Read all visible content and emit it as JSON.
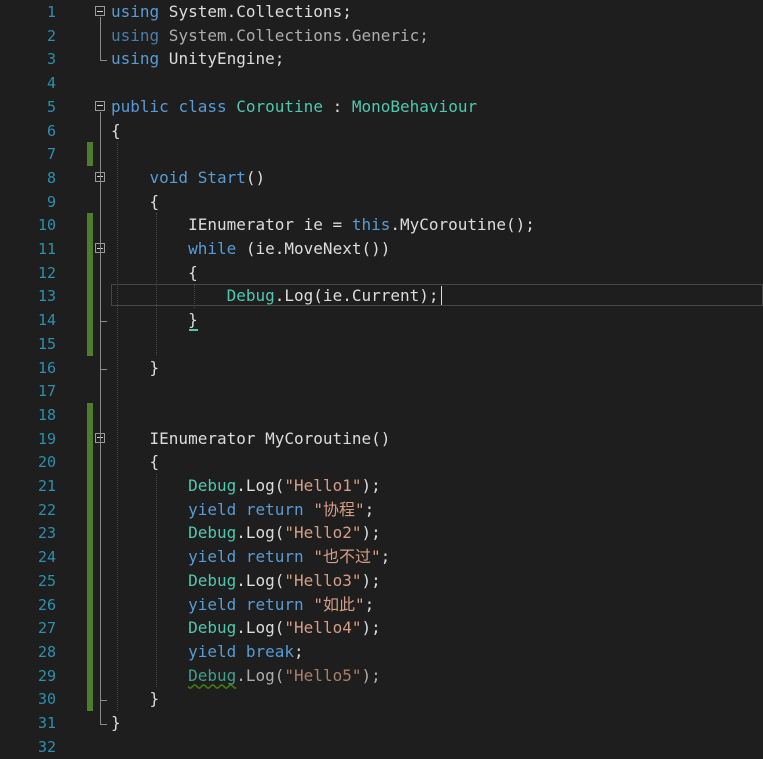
{
  "editor": {
    "lines": [
      {
        "n": "1",
        "tokens": [
          {
            "t": "using",
            "c": "kw"
          },
          {
            "t": " System.Collections;",
            "c": "id"
          }
        ]
      },
      {
        "n": "2",
        "tokens": [
          {
            "t": "using",
            "c": "kw"
          },
          {
            "t": " System.Collections.Generic;",
            "c": "id"
          }
        ],
        "dim": true
      },
      {
        "n": "3",
        "tokens": [
          {
            "t": "using",
            "c": "kw"
          },
          {
            "t": " UnityEngine;",
            "c": "id"
          }
        ]
      },
      {
        "n": "4",
        "tokens": []
      },
      {
        "n": "5",
        "tokens": [
          {
            "t": "public",
            "c": "kw"
          },
          {
            "t": " ",
            "c": "id"
          },
          {
            "t": "class",
            "c": "kw"
          },
          {
            "t": " ",
            "c": "id"
          },
          {
            "t": "Coroutine",
            "c": "type"
          },
          {
            "t": " : ",
            "c": "id"
          },
          {
            "t": "MonoBehaviour",
            "c": "type"
          }
        ]
      },
      {
        "n": "6",
        "tokens": [
          {
            "t": "{",
            "c": "id"
          }
        ]
      },
      {
        "n": "7",
        "tokens": []
      },
      {
        "n": "8",
        "tokens": [
          {
            "t": "    ",
            "c": "id"
          },
          {
            "t": "void",
            "c": "kw"
          },
          {
            "t": " ",
            "c": "id"
          },
          {
            "t": "Start",
            "c": "kw"
          },
          {
            "t": "()",
            "c": "id"
          }
        ]
      },
      {
        "n": "9",
        "tokens": [
          {
            "t": "    {",
            "c": "id"
          }
        ]
      },
      {
        "n": "10",
        "tokens": [
          {
            "t": "        IEnumerator ie = ",
            "c": "id"
          },
          {
            "t": "this",
            "c": "kw"
          },
          {
            "t": ".MyCoroutine();",
            "c": "id"
          }
        ]
      },
      {
        "n": "11",
        "tokens": [
          {
            "t": "        ",
            "c": "id"
          },
          {
            "t": "while",
            "c": "kw"
          },
          {
            "t": " (ie.MoveNext())",
            "c": "id"
          }
        ]
      },
      {
        "n": "12",
        "tokens": [
          {
            "t": "        {",
            "c": "id"
          }
        ]
      },
      {
        "n": "13",
        "tokens": [
          {
            "t": "            ",
            "c": "id"
          },
          {
            "t": "Debug",
            "c": "type"
          },
          {
            "t": ".Log(ie.Current);",
            "c": "id"
          }
        ]
      },
      {
        "n": "14",
        "tokens": [
          {
            "t": "        }",
            "c": "id"
          }
        ]
      },
      {
        "n": "15",
        "tokens": []
      },
      {
        "n": "16",
        "tokens": [
          {
            "t": "    }",
            "c": "id"
          }
        ]
      },
      {
        "n": "17",
        "tokens": []
      },
      {
        "n": "18",
        "tokens": []
      },
      {
        "n": "19",
        "tokens": [
          {
            "t": "    IEnumerator MyCoroutine()",
            "c": "id"
          }
        ]
      },
      {
        "n": "20",
        "tokens": [
          {
            "t": "    {",
            "c": "id"
          }
        ]
      },
      {
        "n": "21",
        "tokens": [
          {
            "t": "        ",
            "c": "id"
          },
          {
            "t": "Debug",
            "c": "type"
          },
          {
            "t": ".Log(",
            "c": "id"
          },
          {
            "t": "\"Hello1\"",
            "c": "str"
          },
          {
            "t": ");",
            "c": "id"
          }
        ]
      },
      {
        "n": "22",
        "tokens": [
          {
            "t": "        ",
            "c": "id"
          },
          {
            "t": "yield",
            "c": "kw"
          },
          {
            "t": " ",
            "c": "id"
          },
          {
            "t": "return",
            "c": "kw"
          },
          {
            "t": " ",
            "c": "id"
          },
          {
            "t": "\"协程\"",
            "c": "str"
          },
          {
            "t": ";",
            "c": "id"
          }
        ]
      },
      {
        "n": "23",
        "tokens": [
          {
            "t": "        ",
            "c": "id"
          },
          {
            "t": "Debug",
            "c": "type"
          },
          {
            "t": ".Log(",
            "c": "id"
          },
          {
            "t": "\"Hello2\"",
            "c": "str"
          },
          {
            "t": ");",
            "c": "id"
          }
        ]
      },
      {
        "n": "24",
        "tokens": [
          {
            "t": "        ",
            "c": "id"
          },
          {
            "t": "yield",
            "c": "kw"
          },
          {
            "t": " ",
            "c": "id"
          },
          {
            "t": "return",
            "c": "kw"
          },
          {
            "t": " ",
            "c": "id"
          },
          {
            "t": "\"也不过\"",
            "c": "str"
          },
          {
            "t": ";",
            "c": "id"
          }
        ]
      },
      {
        "n": "25",
        "tokens": [
          {
            "t": "        ",
            "c": "id"
          },
          {
            "t": "Debug",
            "c": "type"
          },
          {
            "t": ".Log(",
            "c": "id"
          },
          {
            "t": "\"Hello3\"",
            "c": "str"
          },
          {
            "t": ");",
            "c": "id"
          }
        ]
      },
      {
        "n": "26",
        "tokens": [
          {
            "t": "        ",
            "c": "id"
          },
          {
            "t": "yield",
            "c": "kw"
          },
          {
            "t": " ",
            "c": "id"
          },
          {
            "t": "return",
            "c": "kw"
          },
          {
            "t": " ",
            "c": "id"
          },
          {
            "t": "\"如此\"",
            "c": "str"
          },
          {
            "t": ";",
            "c": "id"
          }
        ]
      },
      {
        "n": "27",
        "tokens": [
          {
            "t": "        ",
            "c": "id"
          },
          {
            "t": "Debug",
            "c": "type"
          },
          {
            "t": ".Log(",
            "c": "id"
          },
          {
            "t": "\"Hello4\"",
            "c": "str"
          },
          {
            "t": ");",
            "c": "id"
          }
        ]
      },
      {
        "n": "28",
        "tokens": [
          {
            "t": "        ",
            "c": "id"
          },
          {
            "t": "yield",
            "c": "kw"
          },
          {
            "t": " ",
            "c": "id"
          },
          {
            "t": "break",
            "c": "kw"
          },
          {
            "t": ";",
            "c": "id"
          }
        ]
      },
      {
        "n": "29",
        "tokens": [
          {
            "t": "        ",
            "c": "id"
          },
          {
            "t": "Debug",
            "c": "type",
            "squiggle": true
          },
          {
            "t": ".Log(",
            "c": "id"
          },
          {
            "t": "\"Hello5\"",
            "c": "str"
          },
          {
            "t": ");",
            "c": "id"
          }
        ],
        "dim": true
      },
      {
        "n": "30",
        "tokens": [
          {
            "t": "    }",
            "c": "id"
          }
        ]
      },
      {
        "n": "31",
        "tokens": [
          {
            "t": "}",
            "c": "id"
          }
        ]
      },
      {
        "n": "32",
        "tokens": []
      }
    ],
    "changed_lines": [
      "7",
      "10",
      "11",
      "12",
      "13",
      "14",
      "15",
      "18",
      "19",
      "20",
      "21",
      "22",
      "23",
      "24",
      "25",
      "26",
      "27",
      "28",
      "29",
      "30"
    ],
    "fold_lines": [
      "1",
      "5",
      "8",
      "11",
      "19"
    ],
    "current_line": "13",
    "colors": {
      "background": "#1e1e1e",
      "line_number": "#2b91af",
      "keyword": "#569cd6",
      "type": "#4ec9b0",
      "string": "#d69d85",
      "identifier": "#dcdcdc",
      "change_bar": "#4e7d2c"
    }
  }
}
